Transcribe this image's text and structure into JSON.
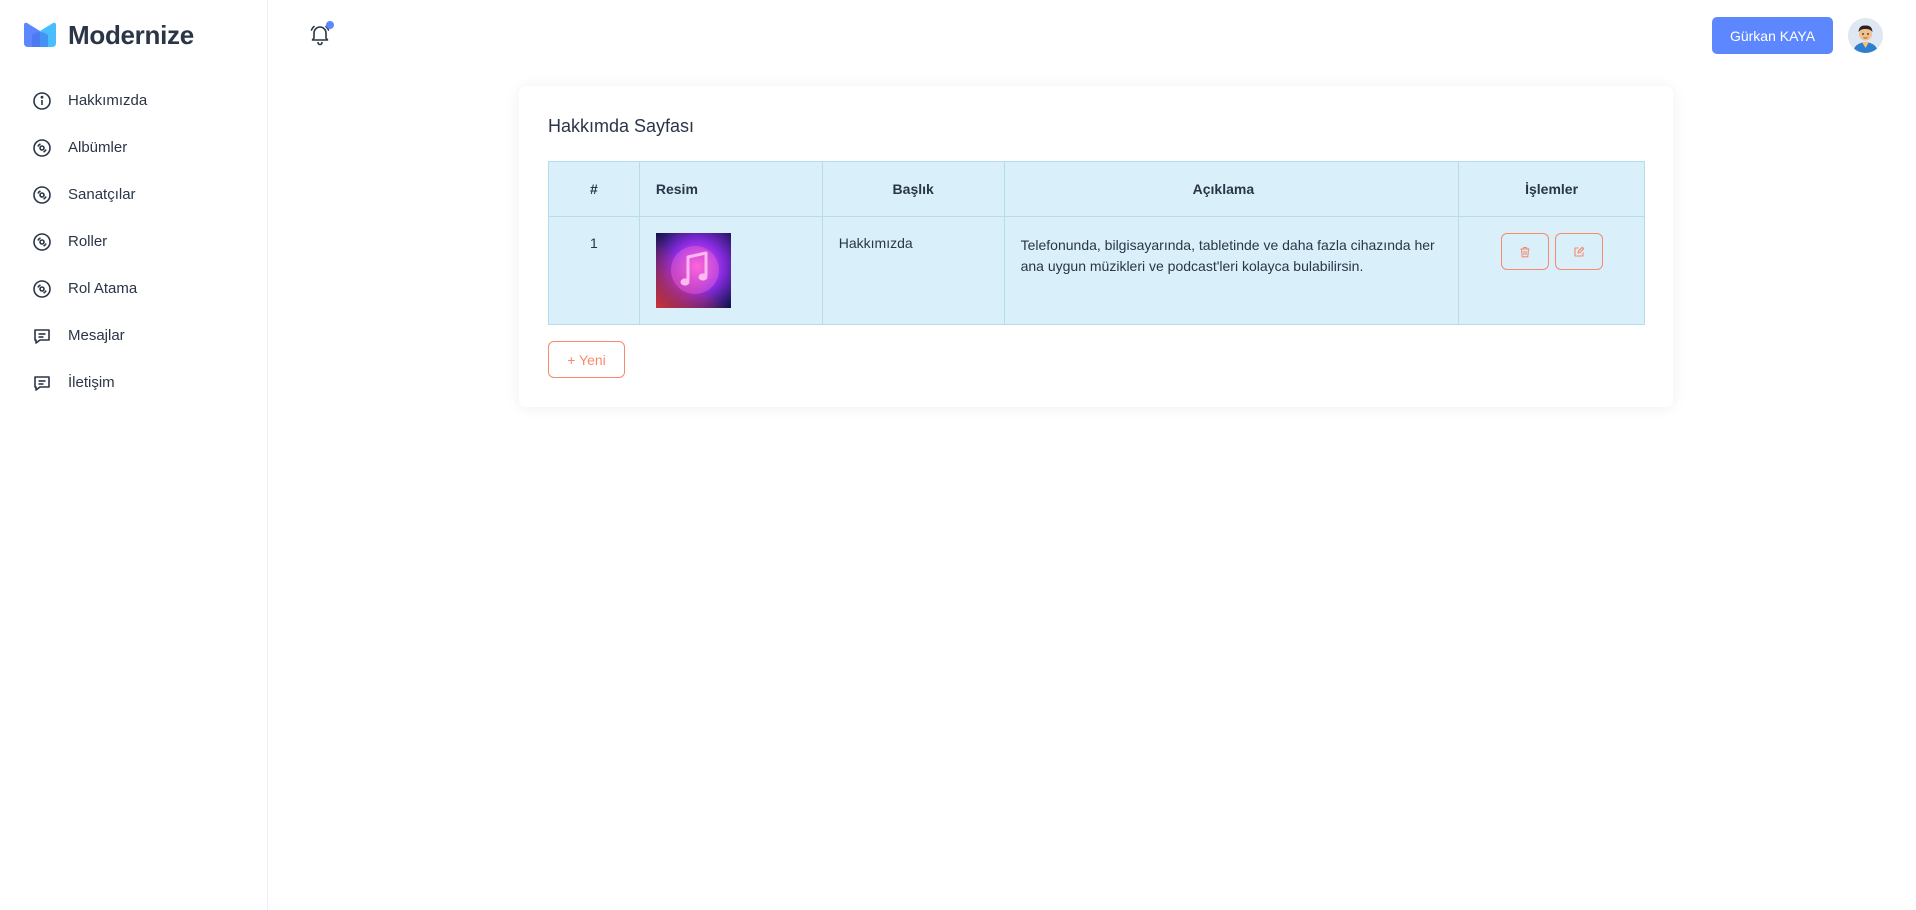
{
  "brand": {
    "name": "Modernize",
    "logo_icon": "modernize-logo-icon",
    "accent": "#5d87ff"
  },
  "sidebar": {
    "items": [
      {
        "label": "Hakkımızda",
        "icon": "info-circle-icon"
      },
      {
        "label": "Albümler",
        "icon": "disc-icon"
      },
      {
        "label": "Sanatçılar",
        "icon": "disc-icon"
      },
      {
        "label": "Roller",
        "icon": "disc-icon"
      },
      {
        "label": "Rol Atama",
        "icon": "disc-icon"
      },
      {
        "label": "Mesajlar",
        "icon": "message-icon"
      },
      {
        "label": "İletişim",
        "icon": "message-icon"
      }
    ]
  },
  "header": {
    "notification_icon": "bell-icon",
    "user_button_label": "Gürkan KAYA",
    "avatar_icon": "user-avatar"
  },
  "main": {
    "title": "Hakkımda Sayfası",
    "table": {
      "columns": [
        "#",
        "Resim",
        "Başlık",
        "Açıklama",
        "İşlemler"
      ],
      "rows": [
        {
          "num": "1",
          "image_icon": "music-note-image",
          "title": "Hakkımızda",
          "description": "Telefonunda, bilgisayarında, tabletinde ve daha fazla cihazında her ana uygun müzikleri ve podcast'leri kolayca bulabilirsin.",
          "actions": [
            "trash-icon",
            "edit-icon"
          ]
        }
      ]
    },
    "new_button_label": "+ Yeni"
  },
  "colors": {
    "primary": "#5d87ff",
    "danger": "#fa896b",
    "table_bg": "#d9f0fb"
  }
}
